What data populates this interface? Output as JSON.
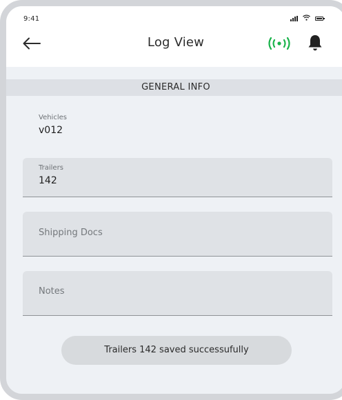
{
  "status_bar": {
    "time": "9:41"
  },
  "header": {
    "title": "Log View"
  },
  "section": {
    "title": "GENERAL INFO"
  },
  "fields": {
    "vehicles": {
      "label": "Vehicles",
      "value": "v012"
    },
    "trailers": {
      "label": "Trailers",
      "value": "142"
    },
    "shipping_docs": {
      "placeholder": "Shipping Docs"
    },
    "notes": {
      "placeholder": "Notes"
    }
  },
  "toast": {
    "message": "Trailers 142 saved successufully"
  },
  "colors": {
    "accent_green": "#19b34a",
    "background": "#eef1f5",
    "field_fill": "#dfe2e6"
  },
  "icons": [
    "back-arrow-icon",
    "radio-signal-icon",
    "bell-icon",
    "cellular-signal-icon",
    "wifi-icon",
    "battery-icon"
  ]
}
